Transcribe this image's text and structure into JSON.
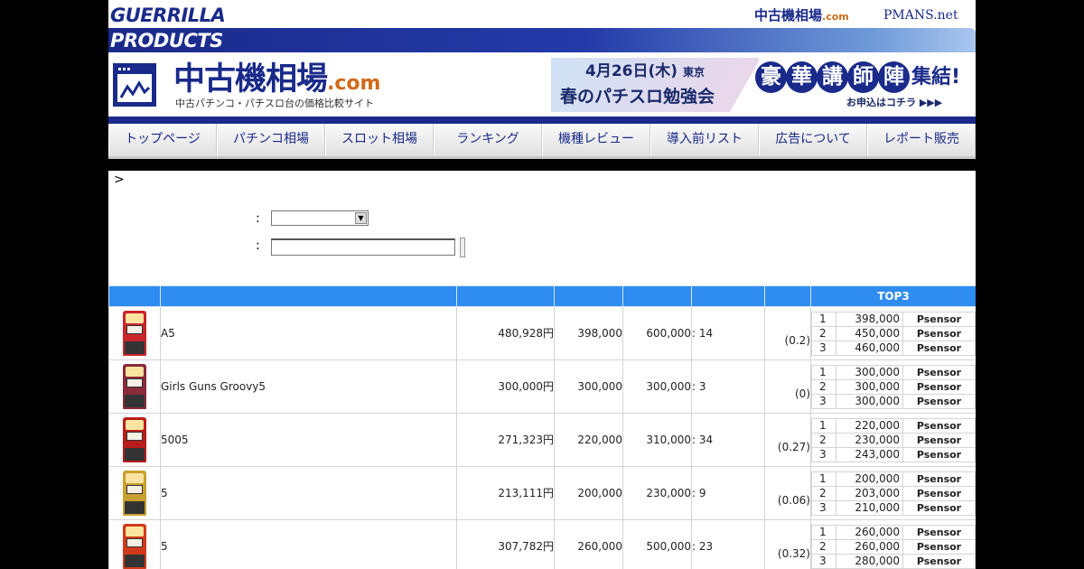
{
  "top": {
    "brand_line1": "GUERRILLA",
    "brand_line2": "PRODUCTS",
    "link_souba_main": "中古機相場",
    "link_souba_dc": ".com",
    "link_pmans": "PMANS.net"
  },
  "header": {
    "logo_main": "中古機相場",
    "logo_dc": ".com",
    "logo_sub": "中古パチンコ・パチスロ台の価格比較サイト",
    "banner": {
      "date": "4月26日(木)",
      "location": "東京",
      "event": "春のパチスロ勉強会",
      "lecturers_chars": [
        "豪",
        "華",
        "講",
        "師",
        "陣"
      ],
      "lecturers_tail": "集結!",
      "apply": "お申込はコチラ ▶▶▶"
    }
  },
  "nav": {
    "items": [
      {
        "label": "トップページ"
      },
      {
        "label": "パチンコ相場"
      },
      {
        "label": "スロット相場"
      },
      {
        "label": "ランキング"
      },
      {
        "label": "機種レビュー"
      },
      {
        "label": "導入前リスト"
      },
      {
        "label": "広告について"
      },
      {
        "label": "レポート販売"
      }
    ]
  },
  "search": {
    "crumb": ">",
    "select_colon": ":",
    "keyword_colon": ":",
    "select_value": "",
    "keyword_value": ""
  },
  "table": {
    "top3_header": "TOP3",
    "rows": [
      {
        "name": "A5",
        "price": "480,928円",
        "min": "398,000",
        "max": "600,000",
        "count": ": 14",
        "ratio": "(0.2)",
        "top3": [
          {
            "rank": "1",
            "price": "398,000",
            "shop": "Psensor"
          },
          {
            "rank": "2",
            "price": "450,000",
            "shop": "Psensor"
          },
          {
            "rank": "3",
            "price": "460,000",
            "shop": "Psensor"
          }
        ],
        "color": "#c8262a"
      },
      {
        "name": "Girls Guns Groovy5",
        "price": "300,000円",
        "min": "300,000",
        "max": "300,000",
        "count": ": 3",
        "ratio": "(0)",
        "top3": [
          {
            "rank": "1",
            "price": "300,000",
            "shop": "Psensor"
          },
          {
            "rank": "2",
            "price": "300,000",
            "shop": "Psensor"
          },
          {
            "rank": "3",
            "price": "300,000",
            "shop": "Psensor"
          }
        ],
        "color": "#8a2a3a"
      },
      {
        "name": "5005",
        "price": "271,323円",
        "min": "220,000",
        "max": "310,000",
        "count": ": 34",
        "ratio": "(0.27)",
        "top3": [
          {
            "rank": "1",
            "price": "220,000",
            "shop": "Psensor"
          },
          {
            "rank": "2",
            "price": "230,000",
            "shop": "Psensor"
          },
          {
            "rank": "3",
            "price": "243,000",
            "shop": "Psensor"
          }
        ],
        "color": "#b81c1c"
      },
      {
        "name": "5",
        "price": "213,111円",
        "min": "200,000",
        "max": "230,000",
        "count": ": 9",
        "ratio": "(0.06)",
        "top3": [
          {
            "rank": "1",
            "price": "200,000",
            "shop": "Psensor"
          },
          {
            "rank": "2",
            "price": "203,000",
            "shop": "Psensor"
          },
          {
            "rank": "3",
            "price": "210,000",
            "shop": "Psensor"
          }
        ],
        "color": "#c8a030"
      },
      {
        "name": "5",
        "price": "307,782円",
        "min": "260,000",
        "max": "500,000",
        "count": ": 23",
        "ratio": "(0.32)",
        "top3": [
          {
            "rank": "1",
            "price": "260,000",
            "shop": "Psensor"
          },
          {
            "rank": "2",
            "price": "260,000",
            "shop": "Psensor"
          },
          {
            "rank": "3",
            "price": "280,000",
            "shop": "Psensor"
          }
        ],
        "color": "#d03a1a"
      }
    ]
  }
}
